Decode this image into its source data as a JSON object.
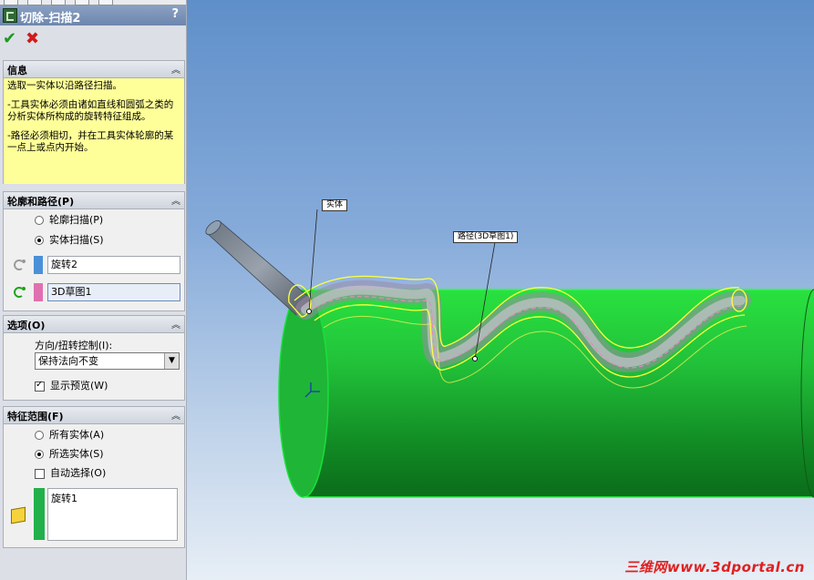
{
  "feature": {
    "title": "切除-扫描2",
    "help": "?"
  },
  "actions": {
    "ok": "✔",
    "cancel": "✖"
  },
  "info": {
    "title": "信息",
    "lines": [
      "选取一实体以沿路径扫描。",
      "-工具实体必须由诸如直线和圆弧之类的分析实体所构成的旋转特征组成。",
      "-路径必须相切，并在工具实体轮廓的某一点上或点内开始。"
    ]
  },
  "profile_path": {
    "title": "轮廓和路径(P)",
    "options": [
      "轮廓扫描(P)",
      "实体扫描(S)"
    ],
    "selected_option": 1,
    "tool_body": "旋转2",
    "path": "3D草图1",
    "tool_color": "#4a90d9",
    "path_color": "#e070b0"
  },
  "options": {
    "title": "选项(O)",
    "orientation_label": "方向/扭转控制(I):",
    "orientation_value": "保持法向不变",
    "show_preview": "显示预览(W)",
    "show_preview_checked": true
  },
  "feature_scope": {
    "title": "特征范围(F)",
    "options": [
      "所有实体(A)",
      "所选实体(S)"
    ],
    "selected_option": 1,
    "auto_select": "自动选择(O)",
    "auto_select_checked": false,
    "bodies": [
      "旋转1"
    ],
    "bodies_color": "#22b04a"
  },
  "viewport": {
    "callout_body": "实体",
    "callout_path": "路径(3D草图1)",
    "watermark": "三维网www.3dportal.cn",
    "cylinder_color": "#22c23a"
  }
}
